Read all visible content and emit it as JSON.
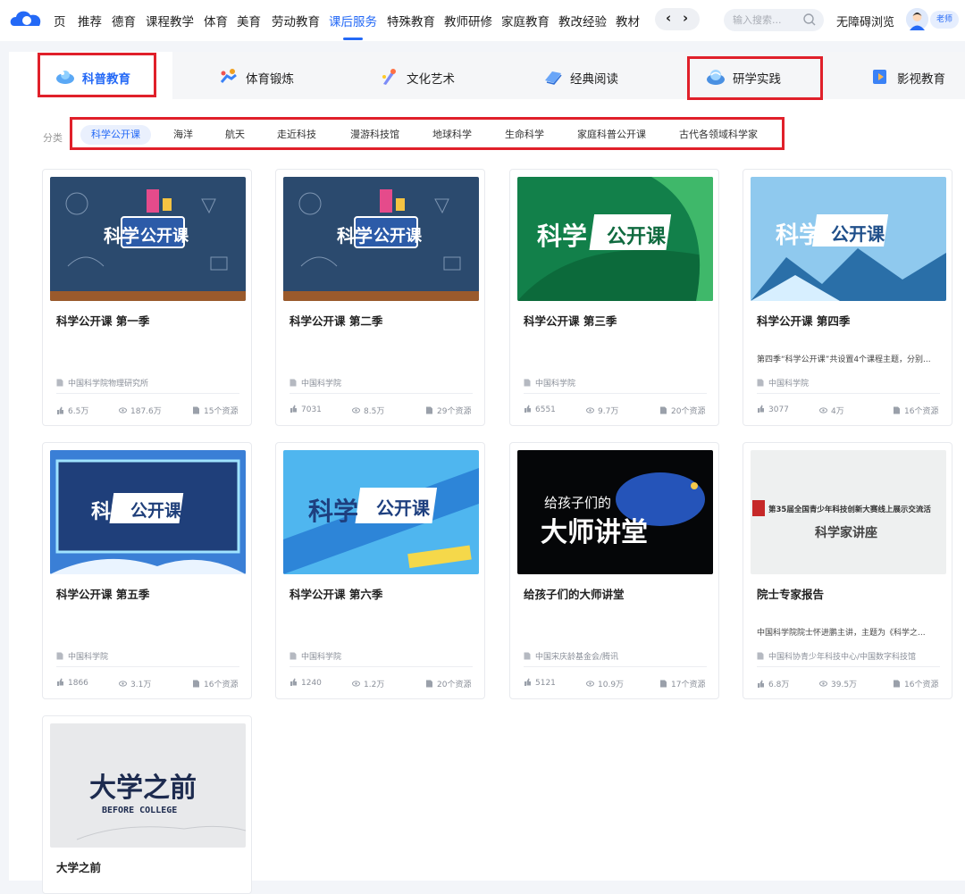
{
  "header": {
    "nav": [
      {
        "label": "页",
        "active": false
      },
      {
        "label": "推荐",
        "active": false
      },
      {
        "label": "德育",
        "active": false
      },
      {
        "label": "课程教学",
        "active": false
      },
      {
        "label": "体育",
        "active": false
      },
      {
        "label": "美育",
        "active": false
      },
      {
        "label": "劳动教育",
        "active": false
      },
      {
        "label": "课后服务",
        "active": true
      },
      {
        "label": "特殊教育",
        "active": false
      },
      {
        "label": "教师研修",
        "active": false
      },
      {
        "label": "家庭教育",
        "active": false
      },
      {
        "label": "教改经验",
        "active": false
      },
      {
        "label": "教材",
        "active": false
      }
    ],
    "prev_glyph": "‹",
    "next_glyph": "›",
    "search_placeholder": "输入搜索...",
    "accessibility_label": "无障碍浏览",
    "role_badge": "老师",
    "accent_color": "#2469f6"
  },
  "category_tabs": [
    {
      "label": "科普教育",
      "icon": "microscope-icon",
      "active": true
    },
    {
      "label": "体育锻炼",
      "icon": "running-figure-icon",
      "active": false
    },
    {
      "label": "文化艺术",
      "icon": "paintbrush-icon",
      "active": false
    },
    {
      "label": "经典阅读",
      "icon": "open-book-icon",
      "active": false
    },
    {
      "label": "研学实践",
      "icon": "globe-cup-icon",
      "active": false
    },
    {
      "label": "影视教育",
      "icon": "film-icon",
      "active": false
    }
  ],
  "filters": {
    "label": "分类",
    "chips": [
      {
        "label": "科学公开课",
        "active": true
      },
      {
        "label": "海洋",
        "active": false
      },
      {
        "label": "航天",
        "active": false
      },
      {
        "label": "走近科技",
        "active": false
      },
      {
        "label": "漫游科技馆",
        "active": false
      },
      {
        "label": "地球科学",
        "active": false
      },
      {
        "label": "生命科学",
        "active": false
      },
      {
        "label": "家庭科普公开课",
        "active": false
      },
      {
        "label": "古代各领域科学家",
        "active": false
      }
    ]
  },
  "highlight_color": "#e0202a",
  "cards": [
    {
      "title": "科学公开课 第一季",
      "desc": "",
      "org": "中国科学院物理研究所",
      "likes": "6.5万",
      "views": "187.6万",
      "resources": "15个资源",
      "thumb_text": "科学公开课"
    },
    {
      "title": "科学公开课 第二季",
      "desc": "",
      "org": "中国科学院",
      "likes": "7031",
      "views": "8.5万",
      "resources": "29个资源",
      "thumb_text": "科学公开课"
    },
    {
      "title": "科学公开课 第三季",
      "desc": "",
      "org": "中国科学院",
      "likes": "6551",
      "views": "9.7万",
      "resources": "20个资源",
      "thumb_text": "科学公开课"
    },
    {
      "title": "科学公开课 第四季",
      "desc": "第四季“科学公开课”共设置4个课程主题，分别...",
      "org": "中国科学院",
      "likes": "3077",
      "views": "4万",
      "resources": "16个资源",
      "thumb_text": "科学公开课"
    },
    {
      "title": "科学公开课 第五季",
      "desc": "",
      "org": "中国科学院",
      "likes": "1866",
      "views": "3.1万",
      "resources": "16个资源",
      "thumb_text": "科学公开课"
    },
    {
      "title": "科学公开课 第六季",
      "desc": "",
      "org": "中国科学院",
      "likes": "1240",
      "views": "1.2万",
      "resources": "20个资源",
      "thumb_text": "科学公开课"
    },
    {
      "title": "给孩子们的大师讲堂",
      "desc": "",
      "org": "中国宋庆龄基金会/腾讯",
      "likes": "5121",
      "views": "10.9万",
      "resources": "17个资源",
      "thumb_text": "给孩子们的",
      "thumb_text2": "大师讲堂"
    },
    {
      "title": "院士专家报告",
      "desc": "中国科学院院士怀进鹏主讲，主题为《科学之...",
      "org": "中国科协青少年科技中心/中国数字科技馆",
      "likes": "6.8万",
      "views": "39.5万",
      "resources": "16个资源",
      "thumb_text": "第35届全国青少年科技创新大赛线上展示交流活",
      "thumb_text2": "科学家讲座"
    },
    {
      "title": "大学之前",
      "desc": "",
      "org": "",
      "likes": "",
      "views": "",
      "resources": "",
      "thumb_text": "大学之前",
      "thumb_text2": "BEFORE COLLEGE"
    }
  ]
}
